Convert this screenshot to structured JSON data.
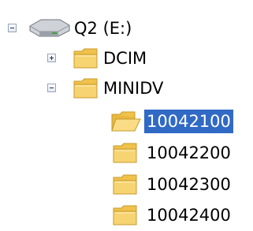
{
  "tree": {
    "drive": {
      "label": "Q2 (E:)",
      "icon": "drive-icon",
      "expanded": true
    },
    "folders": [
      {
        "label": "DCIM",
        "icon": "folder-closed-icon",
        "expanded": false
      },
      {
        "label": "MINIDV",
        "icon": "folder-closed-icon",
        "expanded": true,
        "children": [
          {
            "label": "10042100",
            "icon": "folder-open-icon",
            "selected": true
          },
          {
            "label": "10042200",
            "icon": "folder-closed-icon",
            "selected": false
          },
          {
            "label": "10042300",
            "icon": "folder-closed-icon",
            "selected": false
          },
          {
            "label": "10042400",
            "icon": "folder-closed-icon",
            "selected": false
          }
        ]
      }
    ]
  },
  "colors": {
    "selection_bg": "#316ac5",
    "selection_text": "#ffffff",
    "folder_yellow": "#f7d472",
    "folder_outline": "#c79a2b"
  }
}
